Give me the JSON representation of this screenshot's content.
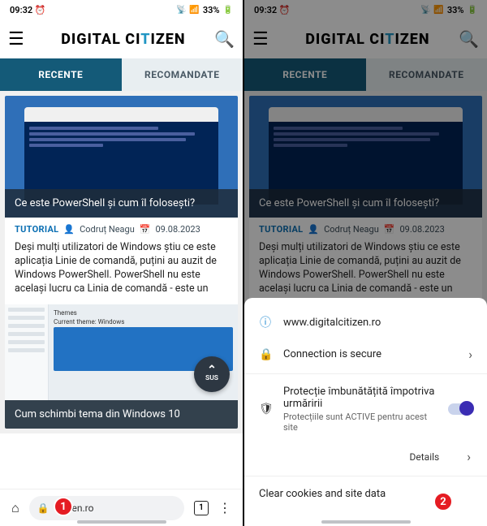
{
  "status": {
    "time": "09:32",
    "alarm": "⏰",
    "extra": "◆",
    "signal": "📶",
    "battery": "33%"
  },
  "brand": {
    "pre": "DIGITAL C",
    "mid": "T",
    "post": "ZEN"
  },
  "tabs": {
    "recent": "RECENTE",
    "recommended": "RECOMANDATE"
  },
  "article1": {
    "title": "Ce este PowerShell și cum îl folosești?",
    "tag": "TUTORIAL",
    "author": "Codruț Neagu",
    "date": "09.08.2023",
    "excerpt": "Deși mulți utilizatori de Windows știu ce este aplicația Linie de comandă, puțini au auzit de Windows PowerShell. PowerShell nu este același lucru ca Linia de comandă - este un"
  },
  "article2": {
    "themes_label": "Themes",
    "themes_current": "Current theme: Windows",
    "sus": "SUS",
    "title": "Cum schimbi tema din Windows 10"
  },
  "toolbar": {
    "url": "citizen.ro",
    "tabcount": "1"
  },
  "sheet": {
    "site": "www.digitalcitizen.ro",
    "secure": "Connection is secure",
    "protection_title": "Protecție îmbunătățită împotriva urmăririi",
    "protection_sub": "Protecțiile sunt ACTIVE pentru acest site",
    "details": "Details",
    "clear": "Clear cookies and site data"
  },
  "badges": {
    "one": "1",
    "two": "2"
  }
}
